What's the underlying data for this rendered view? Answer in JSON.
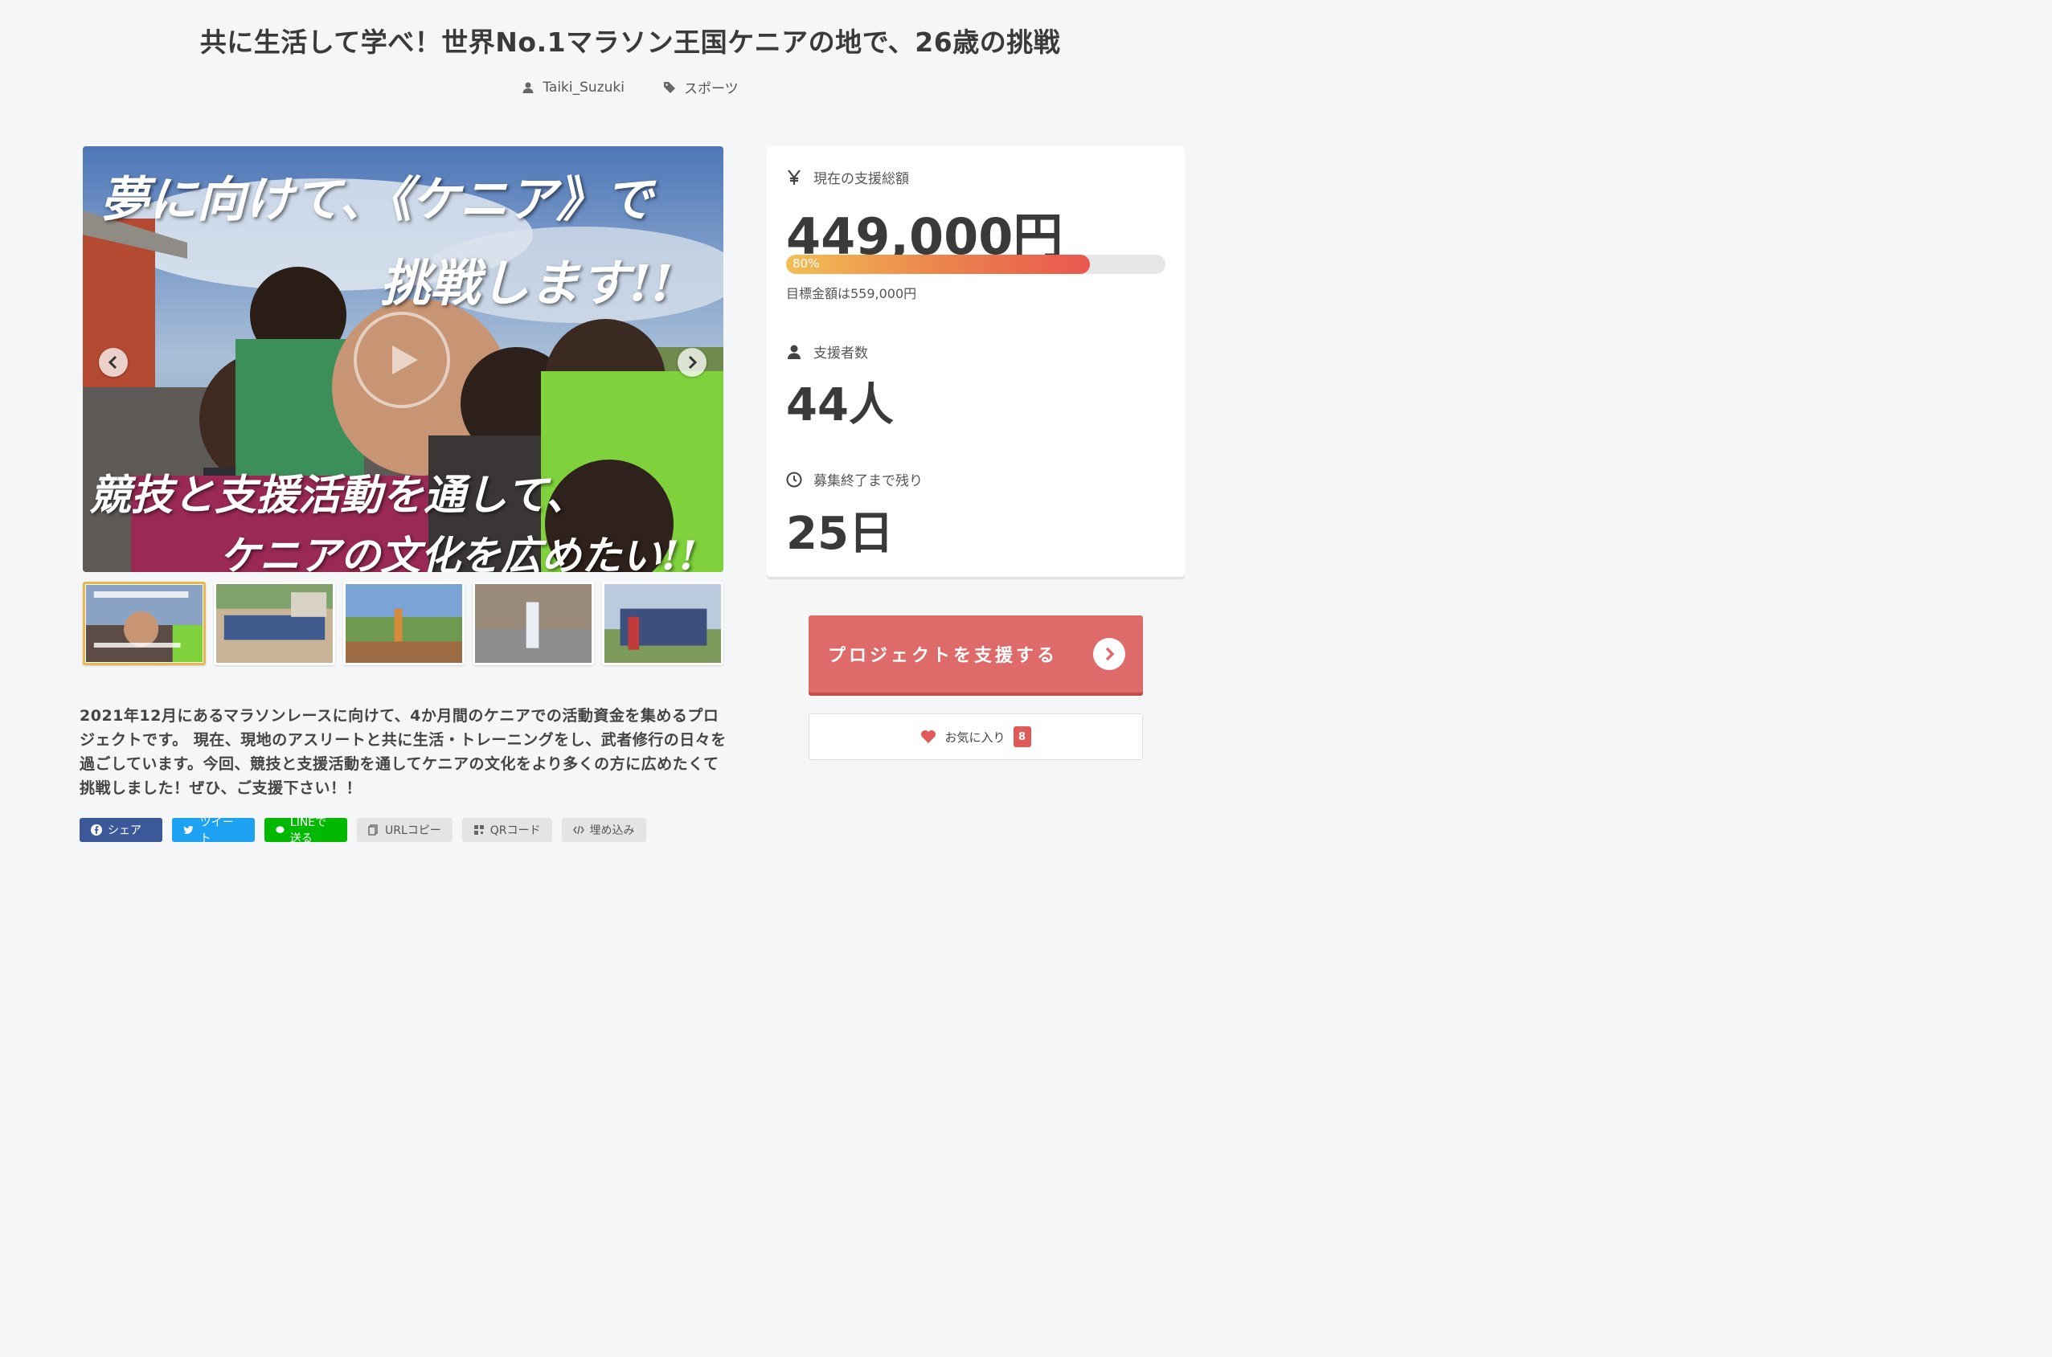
{
  "project": {
    "title": "共に生活して学べ！世界No.1マラソン王国ケニアの地で、26歳の挑戦",
    "author": "Taiki_Suzuki",
    "category": "スポーツ"
  },
  "hero": {
    "line1": "夢に向けて、《ケニア》で",
    "line2": "挑戦します!!",
    "line3": "競技と支援活動を通して、",
    "line4": "ケニアの文化を広めたい!!",
    "icons": [
      "play-icon",
      "chevron-left-icon",
      "chevron-right-icon"
    ]
  },
  "thumbnails": [
    {
      "name": "thumb-1",
      "active": true
    },
    {
      "name": "thumb-2",
      "active": false
    },
    {
      "name": "thumb-3",
      "active": false
    },
    {
      "name": "thumb-4",
      "active": false
    },
    {
      "name": "thumb-5",
      "active": false
    }
  ],
  "description": "2021年12月にあるマラソンレースに向けて、4か月間のケニアでの活動資金を集めるプロジェクトです。 現在、現地のアスリートと共に生活・トレーニングをし、武者修行の日々を過ごしています。今回、競技と支援活動を通してケニアの文化をより多くの方に広めたくて挑戦しました！ぜひ、ご支援下さい！！",
  "share": {
    "facebook": "シェア",
    "twitter": "ツイート",
    "line": "LINEで送る",
    "url_copy": "URLコピー",
    "qr": "QRコード",
    "embed": "埋め込み"
  },
  "stats": {
    "amount_label": "現在の支援総額",
    "amount": "449,000円",
    "progress_text": "80%",
    "progress_fraction": 0.8,
    "goal": "目標金額は559,000円",
    "backers_label": "支援者数",
    "backers": "44人",
    "remaining_label": "募集終了まで残り",
    "remaining": "25日"
  },
  "actions": {
    "support": "プロジェクトを支援する",
    "favorite": "お気に入り",
    "favorite_count": "8"
  },
  "colors": {
    "support": "#de6a6a",
    "progress_start": "#f2bf54",
    "progress_end": "#e9564f",
    "badge": "#e05a5a"
  }
}
